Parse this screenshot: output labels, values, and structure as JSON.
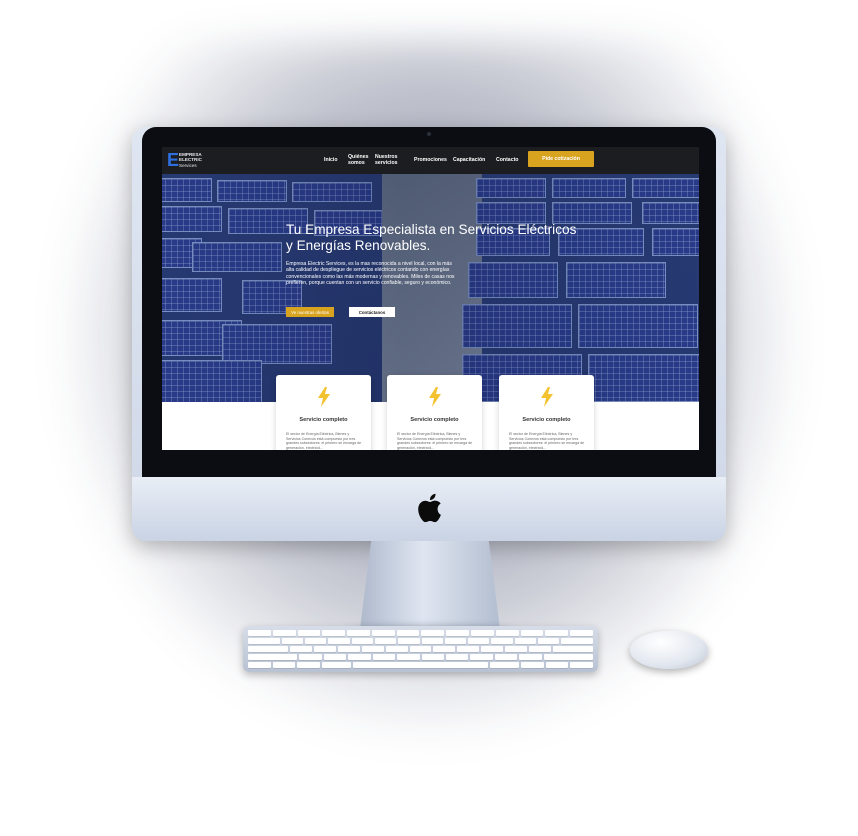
{
  "brand": {
    "mark": "E",
    "line1": "EMPRESA",
    "line2": "ELECTRIC",
    "line3": "Services"
  },
  "nav": {
    "items": [
      "Inicio",
      "Quiénes somos",
      "Nuestros servicios",
      "Promociones",
      "Capacitación",
      "Contacto"
    ],
    "cta_label": "Pide cotización"
  },
  "hero": {
    "title": "Tu Empresa Especialista en Servicios Eléctricos y Energías Renovables.",
    "description": "Empresa Electric Services, es la mas reconocida a nivel local, con la más alta calidad de despliegue de servicios eléctricos contando con energías convencionales como las más modernas y renovables. Miles de casas nos prefieren, porque cuentan con un servicio confiable, seguro y económico.",
    "primary_button": "Ve nuestras ofertas",
    "secondary_button": "Contáctanos"
  },
  "cards": [
    {
      "icon": "lightning-icon",
      "title": "Servicio completo",
      "text": "El sector de Energía Eléctrica, Bienes y Servicios Conexos está compuesto por tres grandes subsectores: el primero se encarga de generación, electricid..."
    },
    {
      "icon": "lightning-icon",
      "title": "Servicio completo",
      "text": "El sector de Energía Eléctrica, Bienes y Servicios Conexos está compuesto por tres grandes subsectores: el primero se encarga de generación, electricid..."
    },
    {
      "icon": "lightning-icon",
      "title": "Servicio completo",
      "text": "El sector de Energía Eléctrica, Bienes y Servicios Conexos está compuesto por tres grandes subsectores: el primero se encarga de generación, electricid..."
    }
  ],
  "colors": {
    "accent": "#d8a420",
    "nav_background": "#1c1d20",
    "logo_blue": "#2e6fe0",
    "hero_blue": "#2b3f7a"
  }
}
